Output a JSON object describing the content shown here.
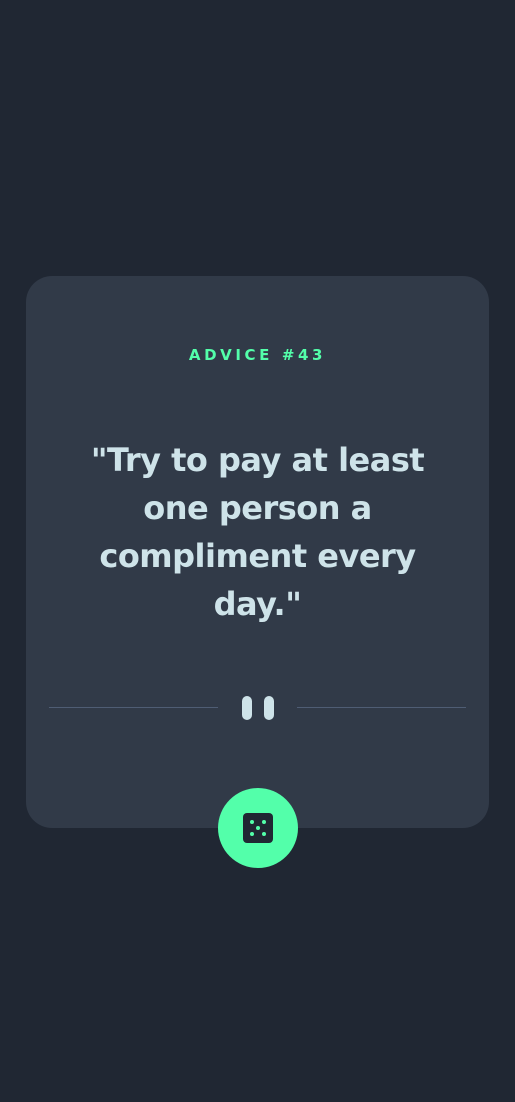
{
  "card": {
    "advice_id": "ADVICE #43",
    "advice_text": "\"Try to pay at least one person a compliment every day.\""
  },
  "icons": {
    "divider_icon": "pause-icon",
    "button_icon": "dice-icon"
  },
  "colors": {
    "background": "#202733",
    "card": "#313a48",
    "accent": "#53ffaa",
    "text": "#cee3e9",
    "divider": "#4f5d74"
  }
}
